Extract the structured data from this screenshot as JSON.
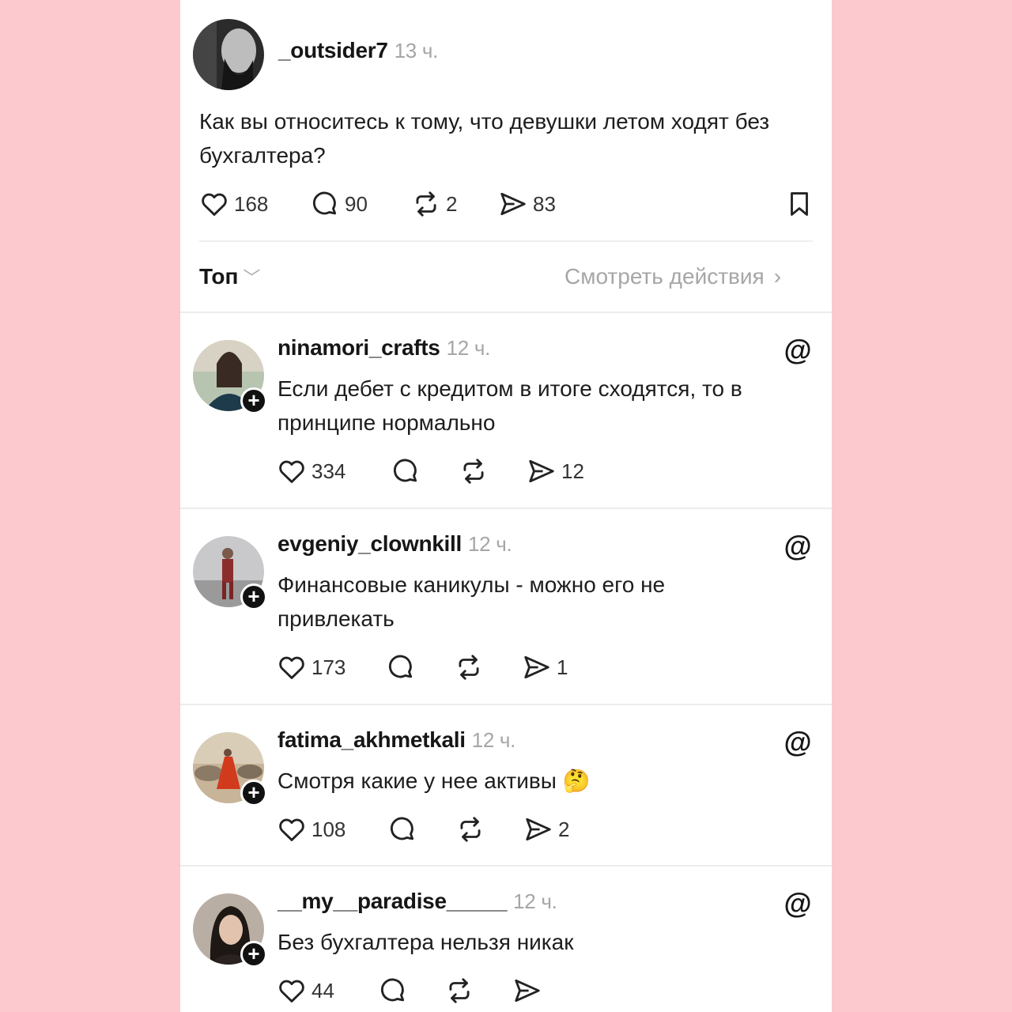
{
  "post": {
    "username": "_outsider7",
    "time": "13 ч.",
    "text": "Как вы относитесь к тому, что девушки летом ходят без бухгалтера?",
    "likes": "168",
    "comments": "90",
    "reposts": "2",
    "shares": "83"
  },
  "sort": {
    "label": "Топ",
    "view_activity": "Смотреть действия"
  },
  "replies": [
    {
      "username": "ninamori_crafts",
      "time": "12 ч.",
      "text": "Если дебет с кредитом в итоге сходятся, то в принципе нормально",
      "likes": "334",
      "shares": "12"
    },
    {
      "username": "evgeniy_clownkill",
      "time": "12 ч.",
      "text": "Финансовые каникулы - можно его не привлекать",
      "likes": "173",
      "shares": "1"
    },
    {
      "username": "fatima_akhmetkali",
      "time": "12 ч.",
      "text": "Смотря какие у нее активы 🤔",
      "likes": "108",
      "shares": "2"
    },
    {
      "username": "__my__paradise_____",
      "time": "12 ч.",
      "text": "Без бухгалтера нельзя никак",
      "likes": "44",
      "shares": ""
    }
  ],
  "icons": [
    "heart-icon",
    "comment-icon",
    "repost-icon",
    "share-icon",
    "bookmark-icon",
    "threads-icon",
    "follow-plus-icon"
  ],
  "colors": {
    "background": "#fcc9ce",
    "panel": "#ffffff",
    "muted": "#a6a6a6"
  }
}
